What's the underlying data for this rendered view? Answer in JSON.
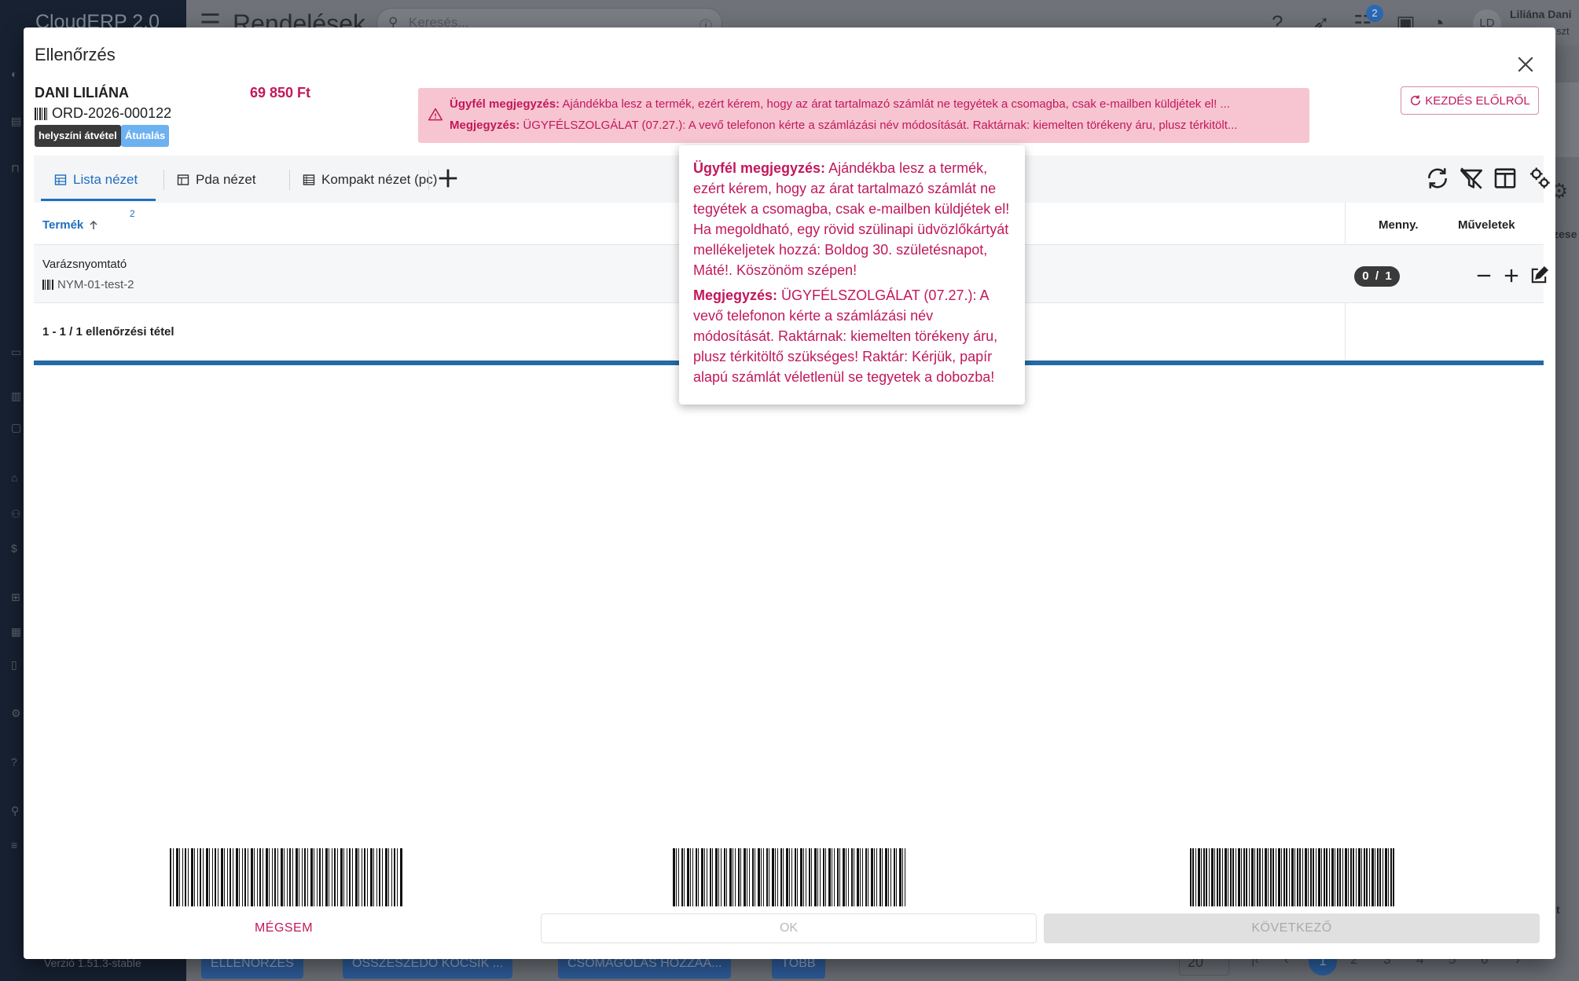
{
  "background": {
    "brand": "CloudERP 2.0",
    "version": "Verzió 1.51.3-stable",
    "page_title": "Rendelések",
    "search_placeholder": "Keresés...",
    "notification_badge": "2",
    "avatar_initials": "LD",
    "user_name": "Liliána Dani",
    "user_role": "szt",
    "right_text_1": "zese",
    "right_text_2": "t",
    "bottom_actions": [
      "ELLENŐRZÉS",
      "ÖSSZESZEDŐ KOCSIK ...",
      "CSOMAGOLÁS HOZZÁA...",
      "TÖBB"
    ],
    "per_page": "20",
    "pages": [
      "1",
      "2",
      "3",
      "4",
      "5",
      "6"
    ]
  },
  "dialog": {
    "title": "Ellenőrzés",
    "customer_name": "DANI LILIÁNA",
    "order_total": "69 850 Ft",
    "order_number": "ORD-2026-000122",
    "chips": [
      "helyszíni átvétel",
      "Átutalás"
    ],
    "notes": {
      "customer_label": "Ügyfél megjegyzés:",
      "customer_text": "Ajándékba lesz a termék, ezért kérem, hogy az árat tartalmazó számlát ne tegyétek a csomagba, csak e-mailben küldjétek el! ...",
      "internal_label": "Megjegyzés:",
      "internal_text": "ÜGYFÉLSZOLGÁLAT (07.27.): A vevő telefonon kérte a számlázási név módosítását. Raktárnak: kiemelten törékeny áru, plusz térkitölt..."
    },
    "restart_label": "KEZDÉS ELŐLRŐL",
    "tabs": [
      "Lista nézet",
      "Pda nézet",
      "Kompakt nézet (pc)"
    ],
    "table": {
      "col_product": "Termék",
      "sort_badge": "2",
      "col_qty": "Menny.",
      "col_actions": "Műveletek",
      "rows": [
        {
          "name": "Varázsnyomtató",
          "sku": "NYM-01-test-2",
          "qty": "0  /  1"
        }
      ],
      "footer": "1 - 1 / 1 ellenőrzési tétel"
    },
    "tooltip": {
      "customer_label": "Ügyfél megjegyzés:",
      "customer_text": " Ajándékba lesz a termék, ezért kérem, hogy az árat tartalmazó számlát ne tegyétek a csomagba, csak e-mailben küldjétek el! Ha megoldható, egy rövid szülinapi üdvözlőkártyát mellékeljetek hozzá: Boldog 30. születésnapot, Máté!. Köszönöm szépen!",
      "internal_label": "Megjegyzés:",
      "internal_text": " ÜGYFÉLSZOLGÁLAT (07.27.): A vevő telefonon kérte a számlázási név módosítását. Raktárnak: kiemelten törékeny áru, plusz térkitöltő szükséges! Raktár: Kérjük, papír alapú számlát véletlenül se tegyetek a dobozba!"
    },
    "buttons": {
      "cancel": "MÉGSEM",
      "ok": "OK",
      "next": "KÖVETKEZŐ"
    }
  },
  "colors": {
    "accent_blue": "#1e6fbf",
    "note_pink": "#c2185b",
    "note_bg": "#f7c5d1",
    "chip_blue": "#6db1f0"
  }
}
